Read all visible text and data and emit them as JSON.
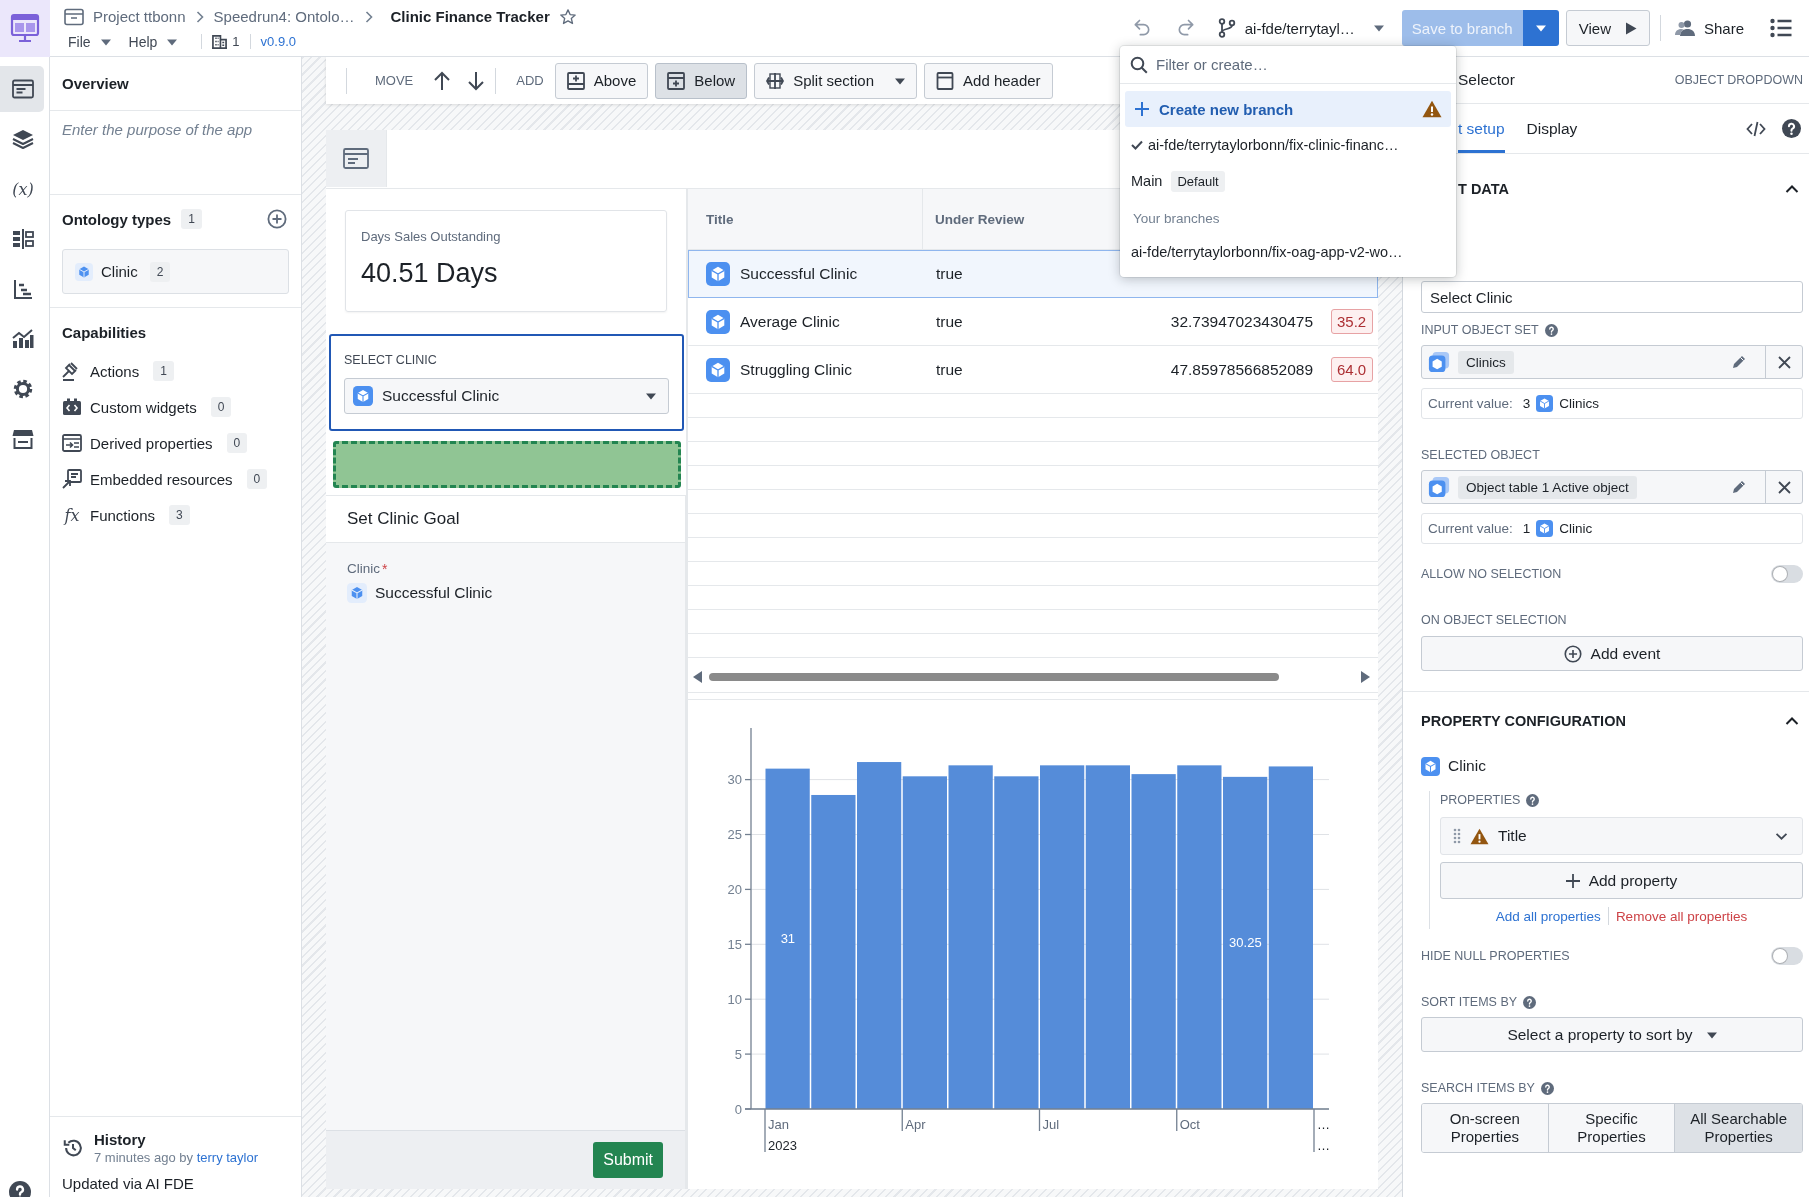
{
  "rail": [
    {
      "kind": "page",
      "selected": true
    },
    {
      "kind": "layers",
      "selected": false
    },
    {
      "kind": "variables",
      "glyph": "(x)",
      "selected": false
    },
    {
      "kind": "layout",
      "selected": false
    },
    {
      "kind": "hierarchy",
      "selected": false
    },
    {
      "kind": "chart",
      "selected": false
    },
    {
      "kind": "settings",
      "selected": false
    },
    {
      "kind": "store",
      "selected": false
    }
  ],
  "header": {
    "breadcrumbs": [
      "Project ttbonn",
      "Speedrun4: Ontolo…"
    ],
    "title": "Clinic Finance Tracker",
    "starred": false,
    "menus": [
      "File",
      "Help"
    ],
    "count": "1",
    "version": "v0.9.0",
    "branch": "ai-fde/terrytayl…",
    "save_button": {
      "label": "Save to branch",
      "disabled": true
    },
    "view_button": "View",
    "share_button": "Share"
  },
  "toolbar": {
    "move_label": "MOVE",
    "add_label": "ADD",
    "buttons": [
      {
        "kind": "above",
        "label": "Above",
        "selected": false
      },
      {
        "kind": "below",
        "label": "Below",
        "selected": true
      },
      {
        "kind": "split",
        "label": "Split section",
        "selected": false
      },
      {
        "kind": "header",
        "label": "Add header",
        "selected": false
      }
    ]
  },
  "left_panel": {
    "overview_title": "Overview",
    "purpose_placeholder": "Enter the purpose of the app",
    "ontology": {
      "title": "Ontology types",
      "count": "1",
      "items": [
        {
          "label": "Clinic",
          "count": "2"
        }
      ]
    },
    "capabilities": {
      "title": "Capabilities",
      "items": [
        {
          "kind": "actions",
          "label": "Actions",
          "count": "1"
        },
        {
          "kind": "widgets",
          "label": "Custom widgets",
          "count": "0"
        },
        {
          "kind": "derived",
          "label": "Derived properties",
          "count": "0"
        },
        {
          "kind": "embedded",
          "label": "Embedded resources",
          "count": "0"
        },
        {
          "kind": "functions",
          "glyph": "fx",
          "label": "Functions",
          "count": "3"
        }
      ]
    },
    "history": {
      "title": "History",
      "meta": "7 minutes ago by",
      "author": "terry taylor",
      "note": "Updated via AI FDE"
    }
  },
  "canvas": {
    "metric": {
      "label": "Days Sales Outstanding",
      "value": "40.51 Days"
    },
    "select_clinic": {
      "label": "SELECT CLINIC",
      "value": "Successful Clinic",
      "selected": true
    },
    "form": {
      "title": "Set Clinic Goal",
      "field_label": "Clinic",
      "required_mark": "*",
      "field_value": "Successful Clinic",
      "submit": "Submit"
    },
    "table": {
      "columns": [
        "Title",
        "Under Review"
      ],
      "rows": [
        {
          "title": "Successful Clinic",
          "under_review": "true",
          "selected": true
        },
        {
          "title": "Average Clinic",
          "under_review": "true",
          "value": "32.73947023430475",
          "badge": "35.2",
          "selected": false
        },
        {
          "title": "Struggling Clinic",
          "under_review": "true",
          "value": "47.85978566852089",
          "badge": "64.0",
          "selected": false
        }
      ]
    },
    "chart": {
      "chart_data": {
        "type": "bar",
        "categories": [
          "Jan",
          null,
          null,
          "Apr",
          null,
          null,
          "Jul",
          null,
          null,
          "Oct",
          null,
          null
        ],
        "series": [
          {
            "color": "#558cd9",
            "values": [
              31,
              28.6,
              31.6,
              30.3,
              31.3,
              30.3,
              31.3,
              31.3,
              30.5,
              31.3,
              30.25,
              31.2
            ]
          }
        ],
        "ylim": [
          0,
          34.7
        ],
        "yticks": [
          0,
          5,
          10,
          15,
          20,
          25,
          30
        ],
        "grid": true,
        "value_labels": [
          "31",
          null,
          null,
          null,
          null,
          null,
          null,
          null,
          null,
          null,
          "30.25",
          null
        ]
      },
      "year_label": "2023",
      "end_marks": [
        "…",
        "…"
      ]
    }
  },
  "branch_menu": {
    "search_placeholder": "Filter or create…",
    "create_label": "Create new branch",
    "create_warning": true,
    "create_highlighted": true,
    "items": [
      {
        "label": "ai-fde/terrytaylorbonn/fix-clinic-financ…",
        "selected": true
      },
      {
        "label": "Main",
        "tag": "Default",
        "selected": false
      }
    ],
    "your_branches": {
      "label": "Your branches",
      "items": [
        {
          "label": "ai-fde/terrytaylorbonn/fix-oag-app-v2-wo…",
          "selected": false
        }
      ]
    }
  },
  "inspector": {
    "title": "Selector",
    "type": "OBJECT DROPDOWN",
    "tabs": [
      {
        "label": "t setup",
        "selected": true
      },
      {
        "label": "Display",
        "selected": false
      }
    ],
    "data_section": {
      "title": "T DATA",
      "expanded": true,
      "label_value": "Select Clinic",
      "input_object_set": {
        "label": "INPUT OBJECT SET",
        "chip": "Clinics",
        "current_label": "Current value:",
        "current_count": "3",
        "current_type": "Clinics"
      },
      "selected_object": {
        "label": "SELECTED OBJECT",
        "chip": "Object table 1 Active object",
        "current_label": "Current value:",
        "current_count": "1",
        "current_type": "Clinic"
      },
      "allow_no_selection": {
        "label": "ALLOW NO SELECTION",
        "on": false
      },
      "on_object_selection": {
        "label": "ON OBJECT SELECTION",
        "button": "Add event"
      }
    },
    "property_section": {
      "title": "PROPERTY CONFIGURATION",
      "expanded": true,
      "object_type": "Clinic",
      "properties_label": "PROPERTIES",
      "properties": [
        {
          "label": "Title",
          "warning": true
        }
      ],
      "add_button": "Add property",
      "add_all": "Add all properties",
      "remove_all": "Remove all properties",
      "hide_null": {
        "label": "HIDE NULL PROPERTIES",
        "on": false
      },
      "sort": {
        "label": "SORT ITEMS BY",
        "prompt": "Select a property to sort by"
      },
      "search": {
        "label": "SEARCH ITEMS BY",
        "options": [
          {
            "label": "On-screen Properties",
            "selected": false
          },
          {
            "label": "Specific Properties",
            "selected": false
          },
          {
            "label": "All Searchable Properties",
            "selected": true
          }
        ]
      }
    }
  }
}
